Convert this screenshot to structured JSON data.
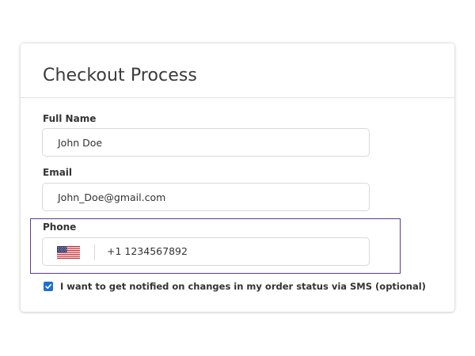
{
  "form": {
    "title": "Checkout Process",
    "full_name": {
      "label": "Full Name",
      "value": "John Doe"
    },
    "email": {
      "label": "Email",
      "value": "John_Doe@gmail.com"
    },
    "phone": {
      "label": "Phone",
      "country_flag_icon": "us-flag-icon",
      "value": "+1 1234567892"
    },
    "sms_opt_in": {
      "checked": true,
      "label": "I want to get notified on changes in my order status via SMS (optional)"
    }
  },
  "colors": {
    "focus_outline": "#5c3b8e",
    "checkbox": "#1f6fd0"
  }
}
